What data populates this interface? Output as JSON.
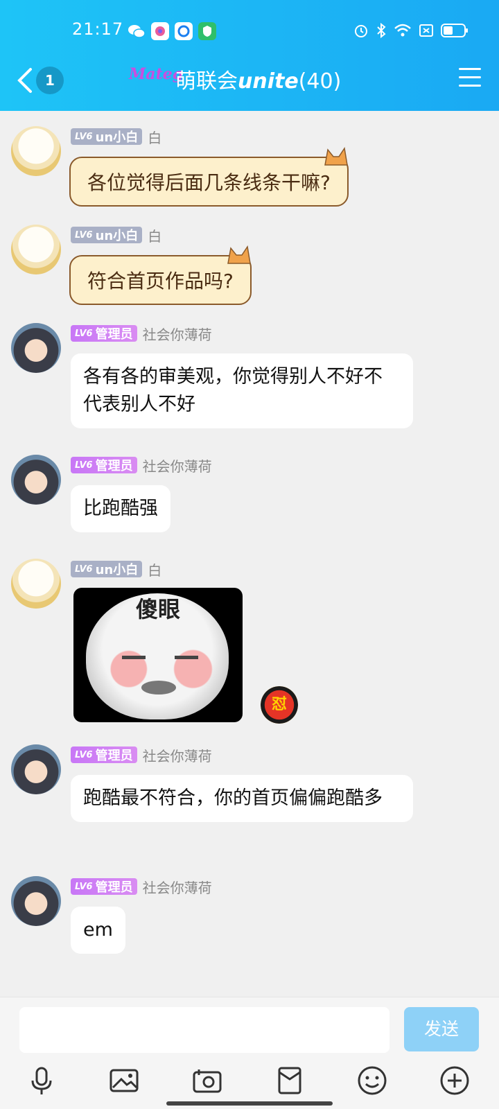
{
  "status_bar": {
    "time": "21:17"
  },
  "header": {
    "unread_count": "1",
    "logo_text": "Mateg",
    "title_cn": "萌联会",
    "title_en": "unite",
    "member_count": "(40)"
  },
  "messages": [
    {
      "level": "LV6",
      "tag": "un小白",
      "nickname": "白",
      "text": "各位觉得后面几条线条干嘛?"
    },
    {
      "level": "LV6",
      "tag": "un小白",
      "nickname": "白",
      "text": "符合首页作品吗?"
    },
    {
      "level": "LV6",
      "tag": "管理员",
      "nickname": "社会你薄荷",
      "text": "各有各的审美观，你觉得别人不好不代表别人不好"
    },
    {
      "level": "LV6",
      "tag": "管理员",
      "nickname": "社会你薄荷",
      "text": "比跑酷强"
    },
    {
      "level": "LV6",
      "tag": "un小白",
      "nickname": "白",
      "sticker_text": "傻眼",
      "badge_text": "怼"
    },
    {
      "level": "LV6",
      "tag": "管理员",
      "nickname": "社会你薄荷",
      "text": "跑酷最不符合，你的首页偏偏跑酷多"
    },
    {
      "level": "LV6",
      "tag": "管理员",
      "nickname": "社会你薄荷",
      "text": "em"
    }
  ],
  "input": {
    "placeholder": "",
    "send_label": "发送"
  },
  "toolbar": {
    "items": [
      "microphone-icon",
      "image-icon",
      "camera-icon",
      "red-envelope-icon",
      "emoji-icon",
      "plus-icon"
    ]
  },
  "colors": {
    "header_start": "#1ec4f7",
    "header_end": "#1aa9f3",
    "admin_tag": "#c877f6",
    "user_tag": "#a9b0c6",
    "send_button": "#8ed1f7"
  }
}
